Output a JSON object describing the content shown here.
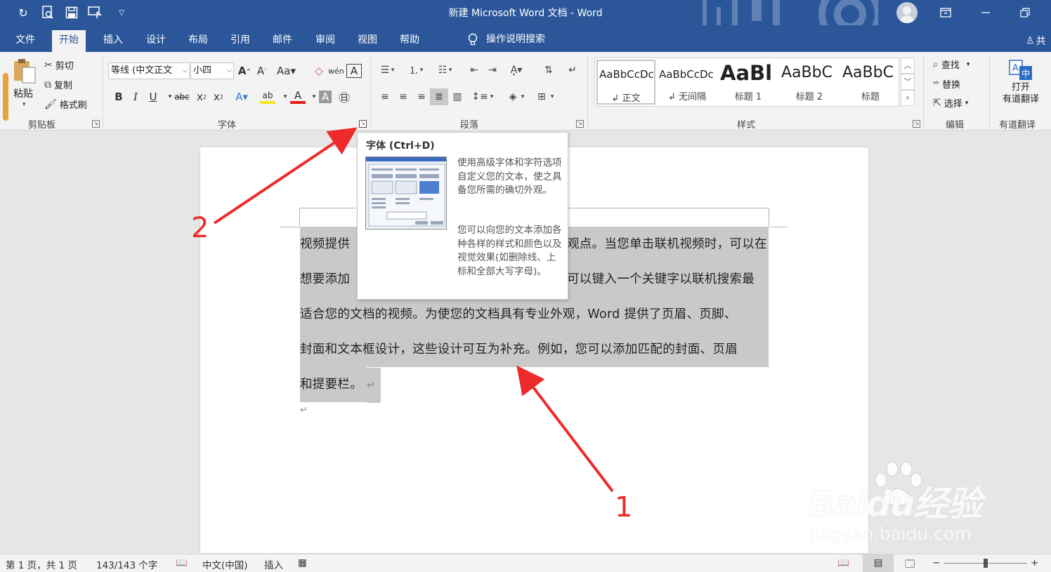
{
  "window": {
    "title": "新建 Microsoft Word 文档  -  Word",
    "controls": [
      "ribbon-display-options",
      "minimize",
      "restore"
    ]
  },
  "quick_access": [
    "redo",
    "print-preview",
    "save",
    "touch-mode",
    "customize"
  ],
  "tabs": [
    "文件",
    "开始",
    "插入",
    "设计",
    "布局",
    "引用",
    "邮件",
    "审阅",
    "视图",
    "帮助"
  ],
  "active_tab": "开始",
  "tell_me": {
    "label": "操作说明搜索"
  },
  "share_label": "共",
  "ribbon": {
    "clipboard": {
      "paste_label": "粘贴",
      "cut_label": "剪切",
      "copy_label": "复制",
      "format_painter_label": "格式刷",
      "group_label": "剪贴板"
    },
    "font": {
      "font_name": "等线 (中文正文",
      "font_size": "小四",
      "group_label": "字体"
    },
    "paragraph": {
      "group_label": "段落"
    },
    "styles": {
      "group_label": "样式",
      "items": [
        {
          "preview": "AaBbCcDc",
          "name": "↲ 正文"
        },
        {
          "preview": "AaBbCcDc",
          "name": "↲ 无间隔"
        },
        {
          "preview": "AaBl",
          "name": "标题 1"
        },
        {
          "preview": "AaBbC",
          "name": "标题 2"
        },
        {
          "preview": "AaBbC",
          "name": "标题"
        }
      ]
    },
    "editing": {
      "find_label": "查找",
      "replace_label": "替换",
      "select_label": "选择",
      "group_label": "编辑"
    },
    "youdao": {
      "button_line1": "打开",
      "button_line2": "有道翻译",
      "group_label": "有道翻译"
    }
  },
  "tooltip": {
    "title": "字体 (Ctrl+D)",
    "para1": "使用高级字体和字符选项自定义您的文本，使之具备您所需的确切外观。",
    "para2": "您可以向您的文本添加各种各样的样式和颜色以及视觉效果(如删除线、上标和全部大写字母)。"
  },
  "document": {
    "lines": [
      {
        "before": "视频提供",
        "after": "观点。当您单击联机视频时，可以在"
      },
      {
        "before": "想要添加",
        "after": "可以键入一个关键字以联机搜索最"
      },
      {
        "text": "适合您的文档的视频。为使您的文档具有专业外观，Word 提供了页眉、页脚、"
      },
      {
        "text": "封面和文本框设计，这些设计可互为补充。例如，您可以添加匹配的封面、页眉"
      },
      {
        "text": "和提要栏。"
      }
    ]
  },
  "annotations": {
    "arrow1_label": "1",
    "arrow2_label": "2",
    "color": "#ee2b2b"
  },
  "status": {
    "page": "第 1 页，共 1 页",
    "words": "143/143 个字",
    "language": "中文(中国)",
    "mode": "插入"
  },
  "watermark": {
    "brand": "Baidu经验",
    "url": "jingyan.baidu.com"
  },
  "colors": {
    "title_bar": "#2b579a",
    "ribbon": "#f3f3f3",
    "selection": "#c9c9c9"
  }
}
